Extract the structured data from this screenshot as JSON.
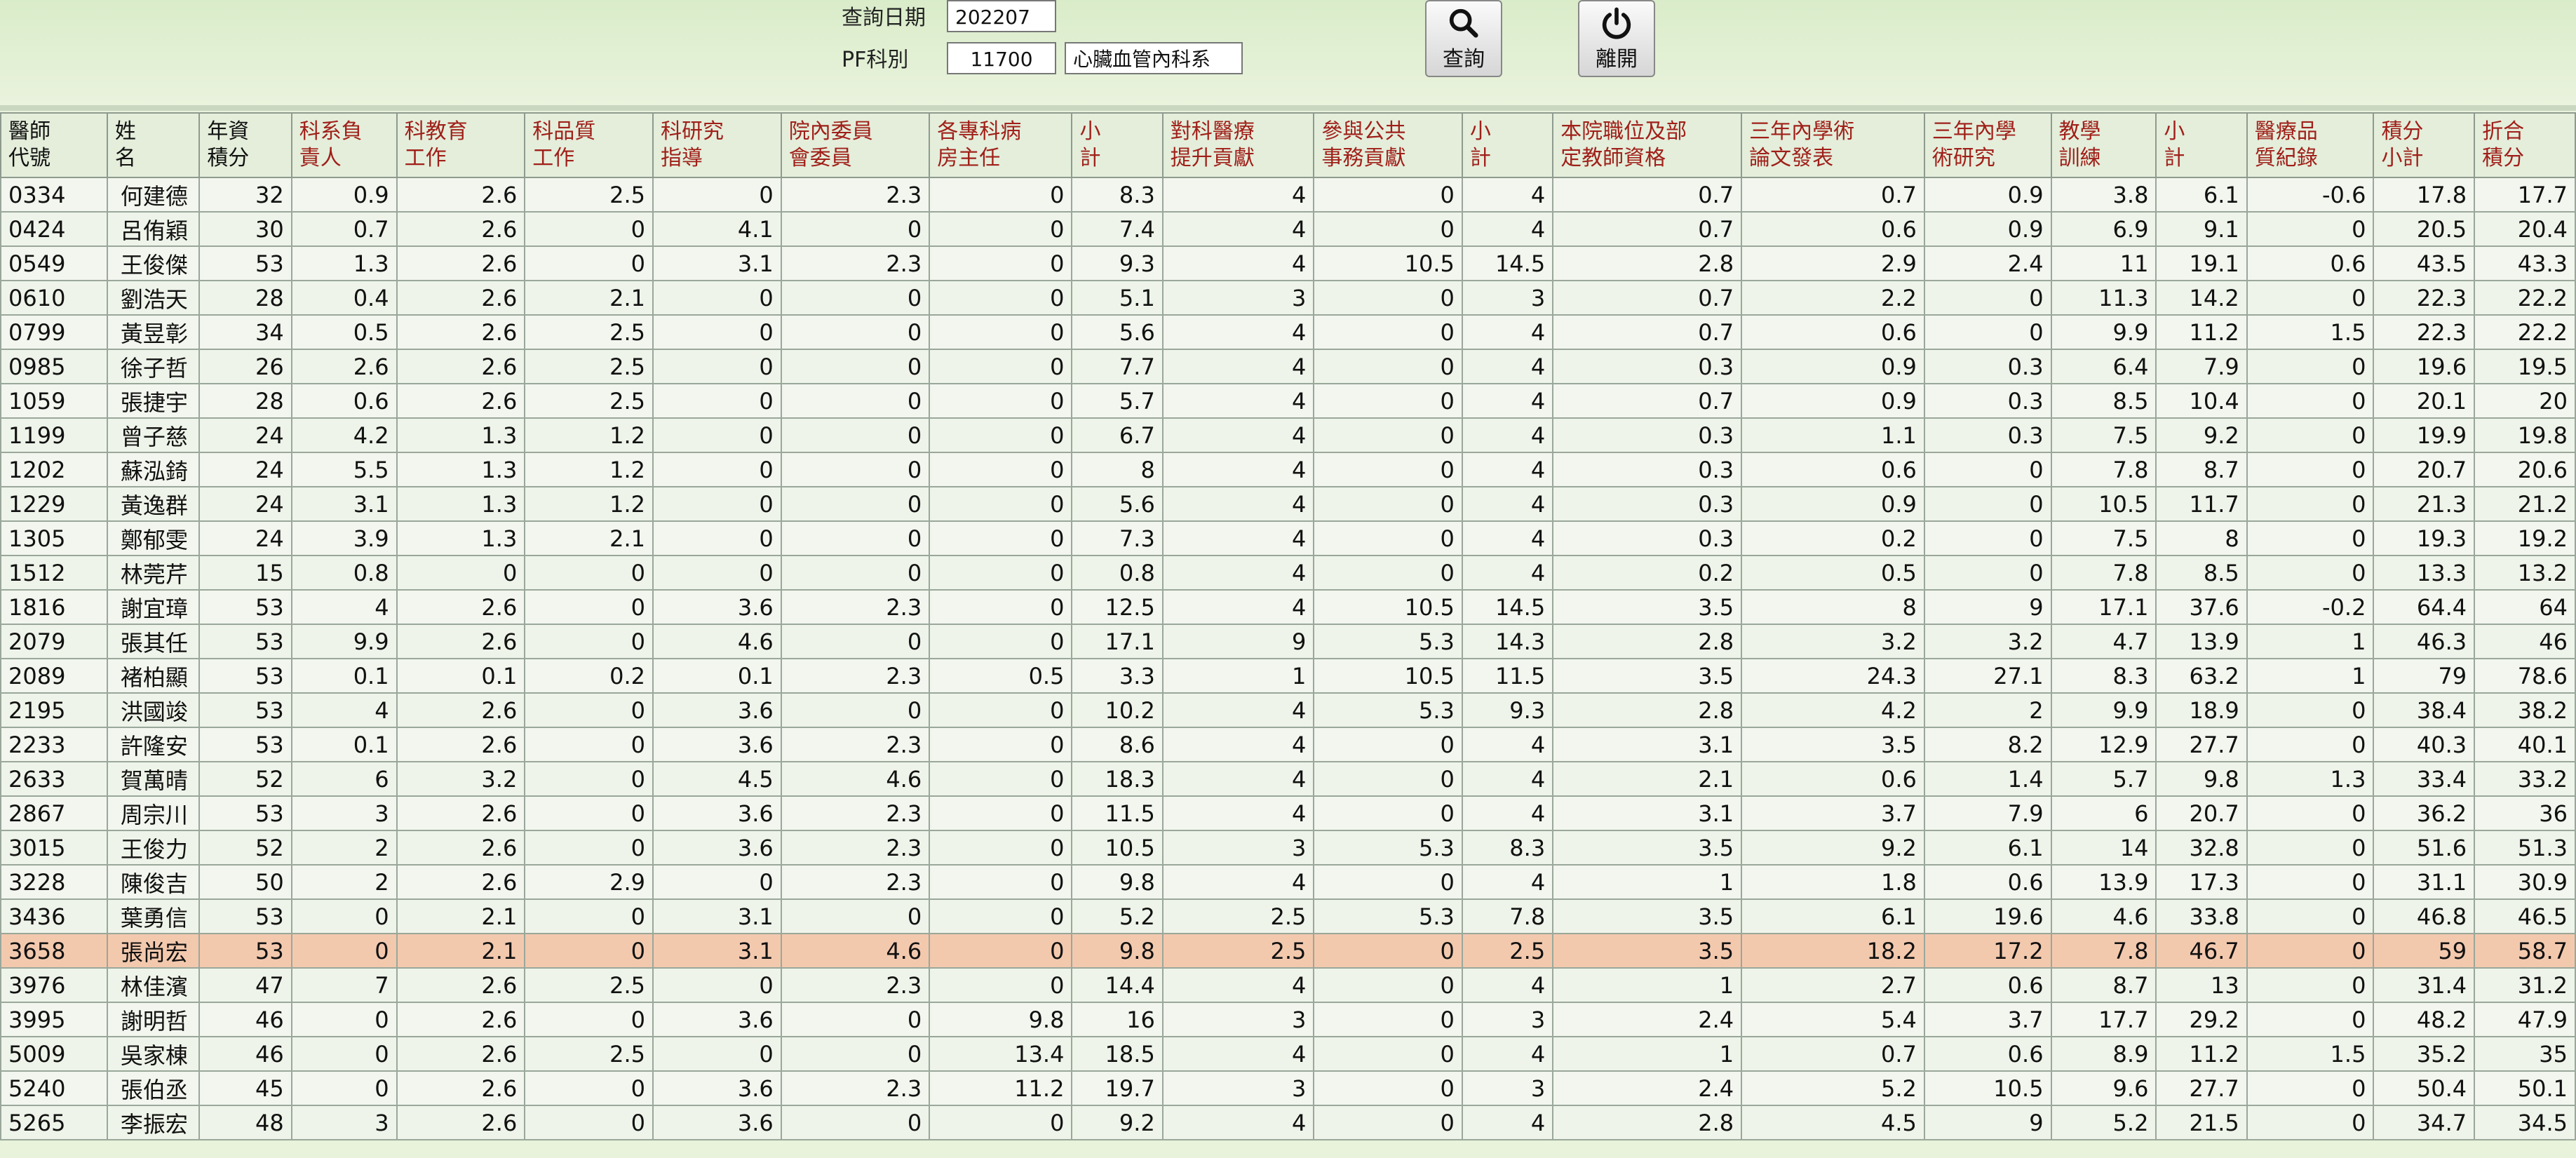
{
  "query": {
    "date_label": "查詢日期",
    "date_value": "202207",
    "dept_label": "PF科別",
    "dept_code": "11700",
    "dept_name": "心臟血管內科系"
  },
  "toolbar": {
    "search_label": "查詢",
    "exit_label": "離開"
  },
  "table": {
    "headers": [
      "醫師\n代號",
      "姓\n名",
      "年資\n積分",
      "科系負\n責人",
      "科教育\n工作",
      "科品質\n工作",
      "科研究\n指導",
      "院內委員\n會委員",
      "各專科病\n房主任",
      "小\n計",
      "對科醫療\n提升貢獻",
      "參與公共\n事務貢獻",
      "小\n計",
      "本院職位及部\n定教師資格",
      "三年內學術\n論文發表",
      "三年內學\n術研究",
      "教學\n訓練",
      "小\n計",
      "醫療品\n質紀錄",
      "積分\n小計",
      "折合\n積分"
    ],
    "rows": [
      [
        "0334",
        "何建德",
        "32",
        "0.9",
        "2.6",
        "2.5",
        "0",
        "2.3",
        "0",
        "8.3",
        "4",
        "0",
        "4",
        "0.7",
        "0.7",
        "0.9",
        "3.8",
        "6.1",
        "-0.6",
        "17.8",
        "17.7"
      ],
      [
        "0424",
        "呂侑穎",
        "30",
        "0.7",
        "2.6",
        "0",
        "4.1",
        "0",
        "0",
        "7.4",
        "4",
        "0",
        "4",
        "0.7",
        "0.6",
        "0.9",
        "6.9",
        "9.1",
        "0",
        "20.5",
        "20.4"
      ],
      [
        "0549",
        "王俊傑",
        "53",
        "1.3",
        "2.6",
        "0",
        "3.1",
        "2.3",
        "0",
        "9.3",
        "4",
        "10.5",
        "14.5",
        "2.8",
        "2.9",
        "2.4",
        "11",
        "19.1",
        "0.6",
        "43.5",
        "43.3"
      ],
      [
        "0610",
        "劉浩天",
        "28",
        "0.4",
        "2.6",
        "2.1",
        "0",
        "0",
        "0",
        "5.1",
        "3",
        "0",
        "3",
        "0.7",
        "2.2",
        "0",
        "11.3",
        "14.2",
        "0",
        "22.3",
        "22.2"
      ],
      [
        "0799",
        "黃昱彰",
        "34",
        "0.5",
        "2.6",
        "2.5",
        "0",
        "0",
        "0",
        "5.6",
        "4",
        "0",
        "4",
        "0.7",
        "0.6",
        "0",
        "9.9",
        "11.2",
        "1.5",
        "22.3",
        "22.2"
      ],
      [
        "0985",
        "徐子哲",
        "26",
        "2.6",
        "2.6",
        "2.5",
        "0",
        "0",
        "0",
        "7.7",
        "4",
        "0",
        "4",
        "0.3",
        "0.9",
        "0.3",
        "6.4",
        "7.9",
        "0",
        "19.6",
        "19.5"
      ],
      [
        "1059",
        "張捷宇",
        "28",
        "0.6",
        "2.6",
        "2.5",
        "0",
        "0",
        "0",
        "5.7",
        "4",
        "0",
        "4",
        "0.7",
        "0.9",
        "0.3",
        "8.5",
        "10.4",
        "0",
        "20.1",
        "20"
      ],
      [
        "1199",
        "曾子慈",
        "24",
        "4.2",
        "1.3",
        "1.2",
        "0",
        "0",
        "0",
        "6.7",
        "4",
        "0",
        "4",
        "0.3",
        "1.1",
        "0.3",
        "7.5",
        "9.2",
        "0",
        "19.9",
        "19.8"
      ],
      [
        "1202",
        "蘇泓錡",
        "24",
        "5.5",
        "1.3",
        "1.2",
        "0",
        "0",
        "0",
        "8",
        "4",
        "0",
        "4",
        "0.3",
        "0.6",
        "0",
        "7.8",
        "8.7",
        "0",
        "20.7",
        "20.6"
      ],
      [
        "1229",
        "黃逸群",
        "24",
        "3.1",
        "1.3",
        "1.2",
        "0",
        "0",
        "0",
        "5.6",
        "4",
        "0",
        "4",
        "0.3",
        "0.9",
        "0",
        "10.5",
        "11.7",
        "0",
        "21.3",
        "21.2"
      ],
      [
        "1305",
        "鄭郁雯",
        "24",
        "3.9",
        "1.3",
        "2.1",
        "0",
        "0",
        "0",
        "7.3",
        "4",
        "0",
        "4",
        "0.3",
        "0.2",
        "0",
        "7.5",
        "8",
        "0",
        "19.3",
        "19.2"
      ],
      [
        "1512",
        "林莞芹",
        "15",
        "0.8",
        "0",
        "0",
        "0",
        "0",
        "0",
        "0.8",
        "4",
        "0",
        "4",
        "0.2",
        "0.5",
        "0",
        "7.8",
        "8.5",
        "0",
        "13.3",
        "13.2"
      ],
      [
        "1816",
        "謝宜璋",
        "53",
        "4",
        "2.6",
        "0",
        "3.6",
        "2.3",
        "0",
        "12.5",
        "4",
        "10.5",
        "14.5",
        "3.5",
        "8",
        "9",
        "17.1",
        "37.6",
        "-0.2",
        "64.4",
        "64"
      ],
      [
        "2079",
        "張其任",
        "53",
        "9.9",
        "2.6",
        "0",
        "4.6",
        "0",
        "0",
        "17.1",
        "9",
        "5.3",
        "14.3",
        "2.8",
        "3.2",
        "3.2",
        "4.7",
        "13.9",
        "1",
        "46.3",
        "46"
      ],
      [
        "2089",
        "褚柏顯",
        "53",
        "0.1",
        "0.1",
        "0.2",
        "0.1",
        "2.3",
        "0.5",
        "3.3",
        "1",
        "10.5",
        "11.5",
        "3.5",
        "24.3",
        "27.1",
        "8.3",
        "63.2",
        "1",
        "79",
        "78.6"
      ],
      [
        "2195",
        "洪國竣",
        "53",
        "4",
        "2.6",
        "0",
        "3.6",
        "0",
        "0",
        "10.2",
        "4",
        "5.3",
        "9.3",
        "2.8",
        "4.2",
        "2",
        "9.9",
        "18.9",
        "0",
        "38.4",
        "38.2"
      ],
      [
        "2233",
        "許隆安",
        "53",
        "0.1",
        "2.6",
        "0",
        "3.6",
        "2.3",
        "0",
        "8.6",
        "4",
        "0",
        "4",
        "3.1",
        "3.5",
        "8.2",
        "12.9",
        "27.7",
        "0",
        "40.3",
        "40.1"
      ],
      [
        "2633",
        "賀萬晴",
        "52",
        "6",
        "3.2",
        "0",
        "4.5",
        "4.6",
        "0",
        "18.3",
        "4",
        "0",
        "4",
        "2.1",
        "0.6",
        "1.4",
        "5.7",
        "9.8",
        "1.3",
        "33.4",
        "33.2"
      ],
      [
        "2867",
        "周宗川",
        "53",
        "3",
        "2.6",
        "0",
        "3.6",
        "2.3",
        "0",
        "11.5",
        "4",
        "0",
        "4",
        "3.1",
        "3.7",
        "7.9",
        "6",
        "20.7",
        "0",
        "36.2",
        "36"
      ],
      [
        "3015",
        "王俊力",
        "52",
        "2",
        "2.6",
        "0",
        "3.6",
        "2.3",
        "0",
        "10.5",
        "3",
        "5.3",
        "8.3",
        "3.5",
        "9.2",
        "6.1",
        "14",
        "32.8",
        "0",
        "51.6",
        "51.3"
      ],
      [
        "3228",
        "陳俊吉",
        "50",
        "2",
        "2.6",
        "2.9",
        "0",
        "2.3",
        "0",
        "9.8",
        "4",
        "0",
        "4",
        "1",
        "1.8",
        "0.6",
        "13.9",
        "17.3",
        "0",
        "31.1",
        "30.9"
      ],
      [
        "3436",
        "葉勇信",
        "53",
        "0",
        "2.1",
        "0",
        "3.1",
        "0",
        "0",
        "5.2",
        "2.5",
        "5.3",
        "7.8",
        "3.5",
        "6.1",
        "19.6",
        "4.6",
        "33.8",
        "0",
        "46.8",
        "46.5"
      ],
      [
        "3658",
        "張尚宏",
        "53",
        "0",
        "2.1",
        "0",
        "3.1",
        "4.6",
        "0",
        "9.8",
        "2.5",
        "0",
        "2.5",
        "3.5",
        "18.2",
        "17.2",
        "7.8",
        "46.7",
        "0",
        "59",
        "58.7"
      ],
      [
        "3976",
        "林佳濱",
        "47",
        "7",
        "2.6",
        "2.5",
        "0",
        "2.3",
        "0",
        "14.4",
        "4",
        "0",
        "4",
        "1",
        "2.7",
        "0.6",
        "8.7",
        "13",
        "0",
        "31.4",
        "31.2"
      ],
      [
        "3995",
        "謝明哲",
        "46",
        "0",
        "2.6",
        "0",
        "3.6",
        "0",
        "9.8",
        "16",
        "3",
        "0",
        "3",
        "2.4",
        "5.4",
        "3.7",
        "17.7",
        "29.2",
        "0",
        "48.2",
        "47.9"
      ],
      [
        "5009",
        "吳家棟",
        "46",
        "0",
        "2.6",
        "2.5",
        "0",
        "0",
        "13.4",
        "18.5",
        "4",
        "0",
        "4",
        "1",
        "0.7",
        "0.6",
        "8.9",
        "11.2",
        "1.5",
        "35.2",
        "35"
      ],
      [
        "5240",
        "張伯丞",
        "45",
        "0",
        "2.6",
        "0",
        "3.6",
        "2.3",
        "11.2",
        "19.7",
        "3",
        "0",
        "3",
        "2.4",
        "5.2",
        "10.5",
        "9.6",
        "27.7",
        "0",
        "50.4",
        "50.1"
      ],
      [
        "5265",
        "李振宏",
        "48",
        "3",
        "2.6",
        "0",
        "3.6",
        "0",
        "0",
        "9.2",
        "4",
        "0",
        "4",
        "2.8",
        "4.5",
        "9",
        "5.2",
        "21.5",
        "0",
        "34.7",
        "34.5"
      ]
    ],
    "selected_row_index": 22
  }
}
